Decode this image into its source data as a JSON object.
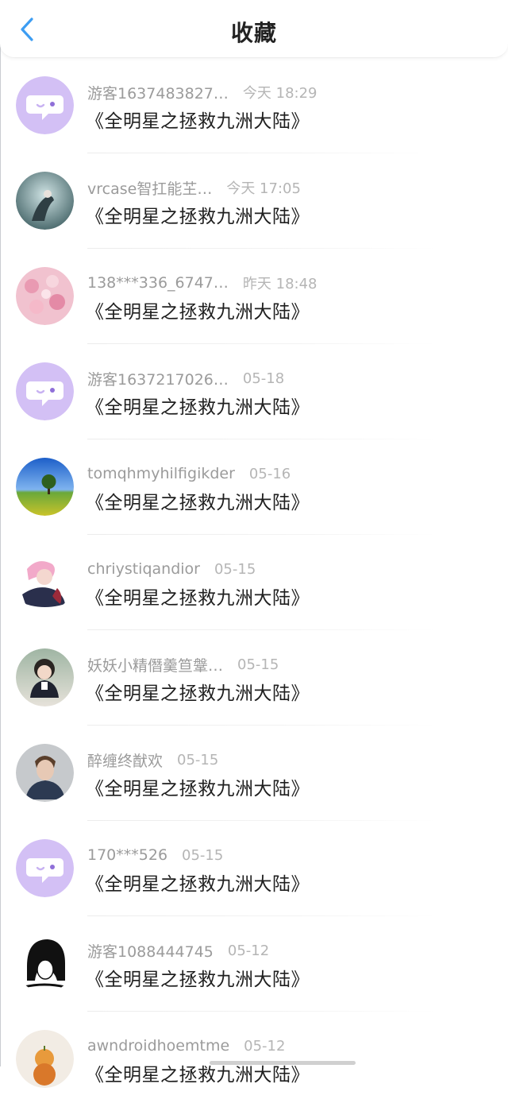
{
  "header": {
    "title": "收藏",
    "back_icon": "chevron-left-icon",
    "accent_color": "#3d9df2"
  },
  "favorites": [
    {
      "avatar": "default-chat-avatar",
      "user": "游客1637483827…",
      "time": "今天 18:29",
      "title": "《全明星之拯救九洲大陆》"
    },
    {
      "avatar": "photo-avatar-teal",
      "user": "vrcase智扛能芏…",
      "time": "今天 17:05",
      "title": "《全明星之拯救九洲大陆》"
    },
    {
      "avatar": "photo-avatar-pink-flowers",
      "user": "138***336_6747…",
      "time": "昨天 18:48",
      "title": "《全明星之拯救九洲大陆》"
    },
    {
      "avatar": "default-chat-avatar",
      "user": "游客1637217026…",
      "time": "05-18",
      "title": "《全明星之拯救九洲大陆》"
    },
    {
      "avatar": "photo-avatar-tree-field",
      "user": "tomqhmyhilfigikder",
      "time": "05-16",
      "title": "《全明星之拯救九洲大陆》"
    },
    {
      "avatar": "photo-avatar-pink-hair",
      "user": "chriystiqandior",
      "time": "05-15",
      "title": "《全明星之拯救九洲大陆》"
    },
    {
      "avatar": "photo-avatar-child",
      "user": "妖妖小精僭羹笪鞶…",
      "time": "05-15",
      "title": "《全明星之拯救九洲大陆》"
    },
    {
      "avatar": "photo-avatar-man",
      "user": "醉缠终猷欢",
      "time": "05-15",
      "title": "《全明星之拯救九洲大陆》"
    },
    {
      "avatar": "default-chat-avatar",
      "user": "170***526",
      "time": "05-15",
      "title": "《全明星之拯救九洲大陆》"
    },
    {
      "avatar": "photo-avatar-black-hair",
      "user": "游客1088444745",
      "time": "05-12",
      "title": "《全明星之拯救九洲大陆》"
    },
    {
      "avatar": "photo-avatar-fruit",
      "user": "awndroidhoemtme",
      "time": "05-12",
      "title": "《全明星之拯救九洲大陆》"
    }
  ]
}
